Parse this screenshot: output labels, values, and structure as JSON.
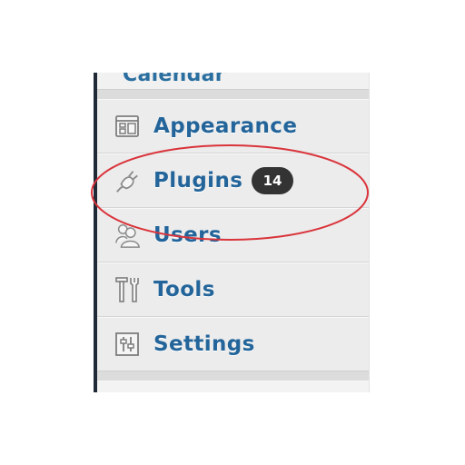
{
  "menu": {
    "partial_item_label": "Calendar",
    "items": [
      {
        "label": "Appearance",
        "icon": "appearance-icon"
      },
      {
        "label": "Plugins",
        "icon": "plugin-icon",
        "badge": "14"
      },
      {
        "label": "Users",
        "icon": "users-icon"
      },
      {
        "label": "Tools",
        "icon": "tools-icon"
      },
      {
        "label": "Settings",
        "icon": "settings-icon"
      }
    ]
  },
  "colors": {
    "menu_background": "#ececec",
    "label_blue": "#23659a",
    "badge_background": "#333333",
    "annotation_red": "#d9343b",
    "sidebar_edge": "#1f2a36"
  }
}
